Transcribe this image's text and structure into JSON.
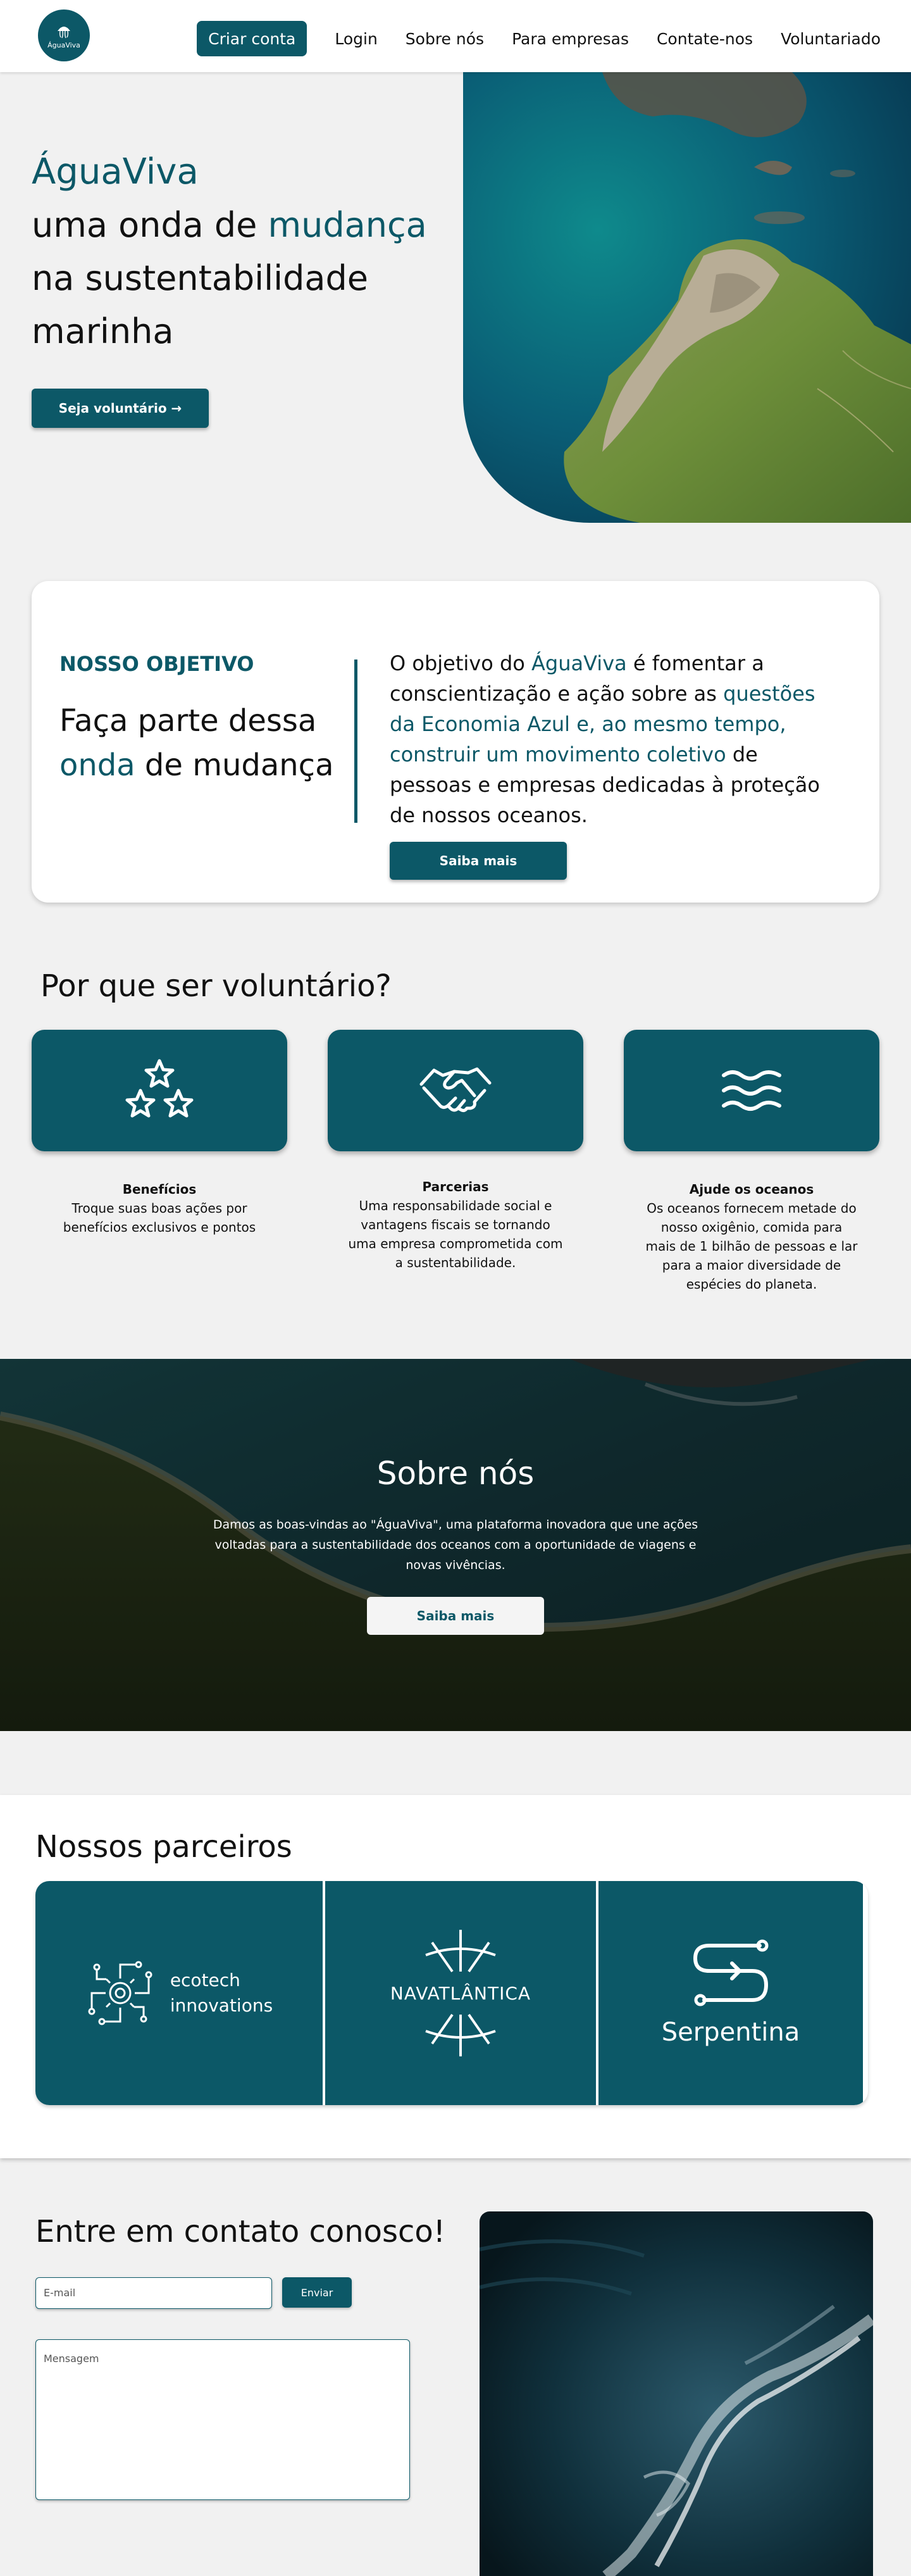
{
  "header": {
    "logo_text": "ÁguaViva",
    "nav": [
      "Criar conta",
      "Login",
      "Sobre nós",
      "Para empresas",
      "Contate-nos",
      "Voluntariado"
    ]
  },
  "hero": {
    "brand": "ÁguaViva",
    "line2_a": "uma onda de ",
    "line2_b": "mudança",
    "line3": "na sustentabilidade",
    "line4": "marinha",
    "cta": "Seja voluntário →"
  },
  "objective": {
    "kicker": "NOSSO OBJETIVO",
    "title_a": "Faça parte dessa",
    "title_b": "onda",
    "title_c": " de mudança",
    "text_a": "O objetivo do ",
    "text_b": "ÁguaViva",
    "text_c": " é fomentar a conscientização e ação sobre as ",
    "text_d": "questões da Economia Azul e, ao mesmo tempo, construir um movimento coletivo",
    "text_e": " de pessoas e empresas dedicadas à proteção de nossos oceanos.",
    "cta": "Saiba mais"
  },
  "why": {
    "title": "Por que ser voluntário?",
    "items": [
      {
        "icon": "stars-icon",
        "title": "Benefícios",
        "text": "Troque suas boas ações por benefícios exclusivos e pontos"
      },
      {
        "icon": "handshake-icon",
        "title": "Parcerias",
        "text": "Uma responsabilidade social e vantagens fiscais se tornando uma empresa comprometida com a sustentabilidade."
      },
      {
        "icon": "waves-icon",
        "title": "Ajude os oceanos",
        "text": "Os  oceanos fornecem metade do nosso oxigênio, comida para mais de 1 bilhão  de pessoas e lar para a maior diversidade de espécies do planeta."
      }
    ]
  },
  "about": {
    "title": "Sobre nós",
    "text": "Damos as boas-vindas ao \"ÁguaViva\", uma plataforma inovadora que une ações voltadas para a sustentabilidade dos oceanos com a oportunidade de viagens e novas vivências.",
    "cta": "Saiba mais"
  },
  "partners": {
    "title": "Nossos parceiros",
    "items": [
      "ecotech innovations",
      "NAVATLÂNTICA",
      "Serpentina"
    ],
    "ecotech_line1": "ecotech",
    "ecotech_line2": "innovations"
  },
  "contact": {
    "title": "Entre em contato conosco!",
    "email_placeholder": "E-mail",
    "send": "Enviar",
    "message_placeholder": "Mensagem"
  },
  "colors": {
    "accent": "#0c5867",
    "background": "#f1f1f1"
  }
}
